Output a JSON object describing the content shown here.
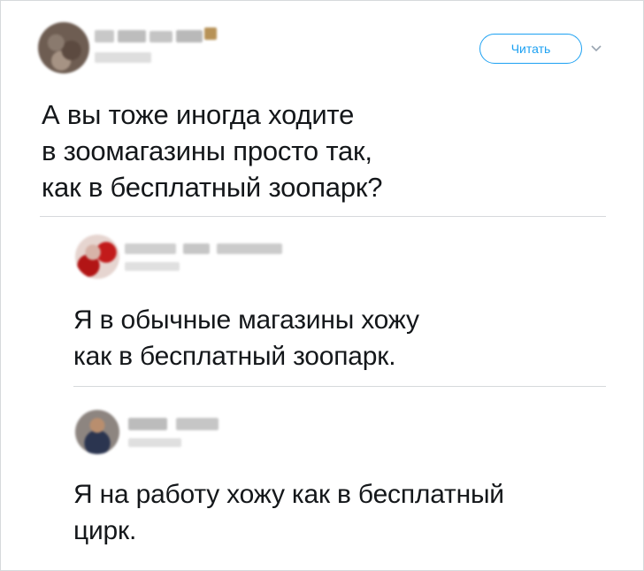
{
  "header": {
    "follow_label": "Читать",
    "chevron_icon": "chevron-down-icon",
    "accent_color": "#1da1f2"
  },
  "main_tweet": {
    "lines": [
      "А вы тоже иногда ходите",
      "в зоомагазины просто так,",
      "как в бесплатный зоопарк?"
    ]
  },
  "replies": [
    {
      "lines": [
        "Я в обычные магазины хожу",
        "как в бесплатный зоопарк."
      ]
    },
    {
      "lines": [
        "Я на работу хожу как в бесплатный",
        "цирк."
      ]
    }
  ]
}
